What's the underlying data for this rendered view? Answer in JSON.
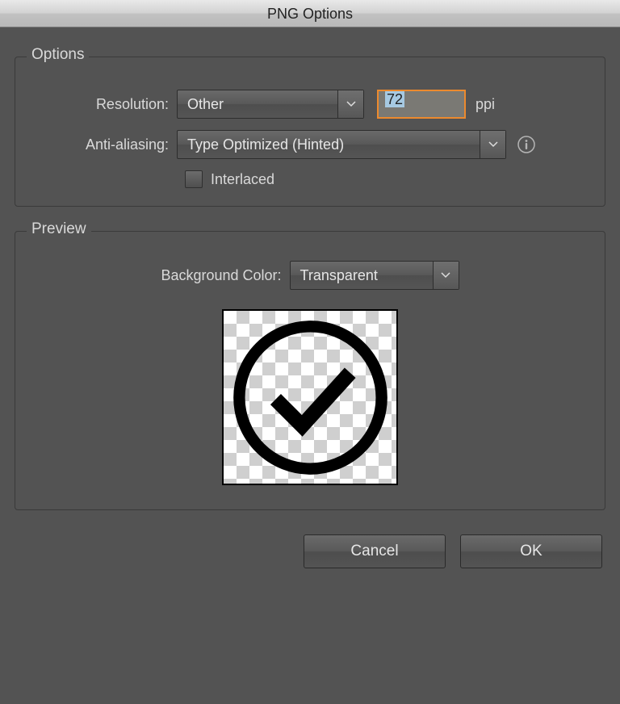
{
  "title": "PNG Options",
  "options": {
    "legend": "Options",
    "resolution_label": "Resolution:",
    "resolution_value": "Other",
    "resolution_number": "72",
    "resolution_unit": "ppi",
    "antialias_label": "Anti-aliasing:",
    "antialias_value": "Type Optimized (Hinted)",
    "interlaced_label": "Interlaced",
    "interlaced_checked": false
  },
  "preview": {
    "legend": "Preview",
    "bg_label": "Background Color:",
    "bg_value": "Transparent"
  },
  "buttons": {
    "cancel": "Cancel",
    "ok": "OK"
  }
}
